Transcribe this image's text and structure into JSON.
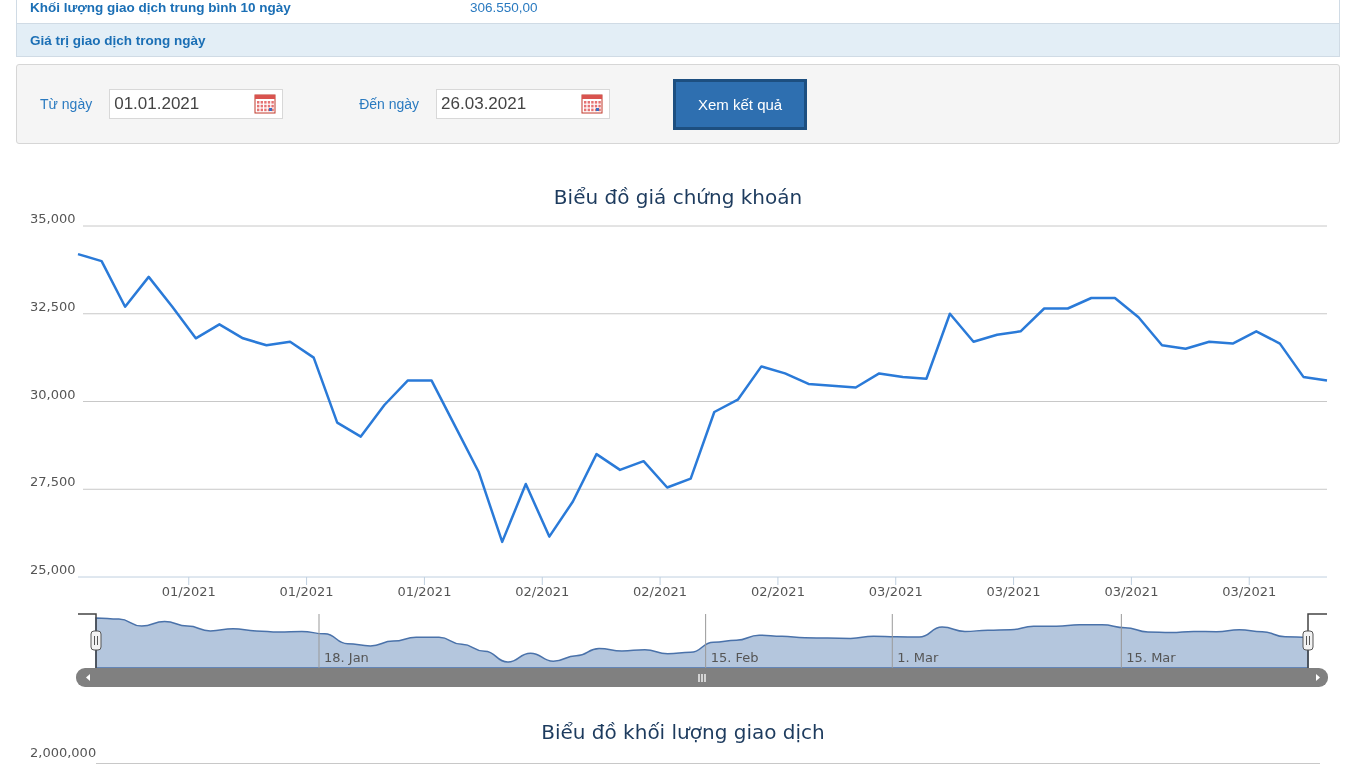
{
  "info_table": {
    "rows": [
      {
        "label": "Khối lượng giao dịch trung bình 10 ngày",
        "value": "306.550,00"
      }
    ],
    "section_header": "Giá trị giao dịch trong ngày"
  },
  "filter": {
    "from_label": "Từ ngày",
    "from_value": "01.01.2021",
    "to_label": "Đến ngày",
    "to_value": "26.03.2021",
    "submit": "Xem kết quả"
  },
  "price_chart": {
    "chart_data": {
      "type": "line",
      "title": "Biểu đồ giá chứng khoán",
      "categories": [
        null,
        null,
        null,
        null,
        null,
        "01/2021",
        null,
        null,
        null,
        null,
        "01/2021",
        null,
        null,
        null,
        null,
        "01/2021",
        null,
        null,
        null,
        null,
        "02/2021",
        null,
        null,
        null,
        null,
        "02/2021",
        null,
        null,
        null,
        null,
        "02/2021",
        null,
        null,
        null,
        null,
        "03/2021",
        null,
        null,
        null,
        null,
        "03/2021",
        null,
        null,
        null,
        null,
        "03/2021",
        null,
        null,
        null,
        null,
        "03/2021",
        null,
        null,
        null
      ],
      "series": [
        {
          "color": "#2a7ad8",
          "values": [
            34200,
            34000,
            32700,
            33550,
            32700,
            31800,
            32200,
            31800,
            31600,
            31700,
            31250,
            29400,
            29000,
            29900,
            30600,
            30600,
            29300,
            28000,
            26000,
            27650,
            26150,
            27150,
            28500,
            28050,
            28300,
            27550,
            27800,
            29700,
            30050,
            31000,
            30800,
            30500,
            30450,
            30400,
            30800,
            30700,
            30650,
            32500,
            31700,
            31900,
            32000,
            32650,
            32650,
            32950,
            32950,
            32400,
            31600,
            31500,
            31700,
            31650,
            32000,
            31650,
            30700,
            30600
          ]
        }
      ],
      "ylim": [
        25000,
        35000
      ],
      "grid": true,
      "yticks": [
        {
          "value": 25000,
          "label": "25,000"
        },
        {
          "value": 27500,
          "label": "27,500"
        },
        {
          "value": 30000,
          "label": "30,000"
        },
        {
          "value": 32500,
          "label": "32,500"
        },
        {
          "value": 35000,
          "label": "35,000"
        }
      ]
    },
    "navigator": {
      "labels": [
        "18. Jan",
        "15. Feb",
        "1. Mar",
        "15. Mar"
      ]
    }
  },
  "volume_chart": {
    "title": "Biểu đồ khối lượng giao dịch",
    "top_tick": "2,000,000"
  }
}
